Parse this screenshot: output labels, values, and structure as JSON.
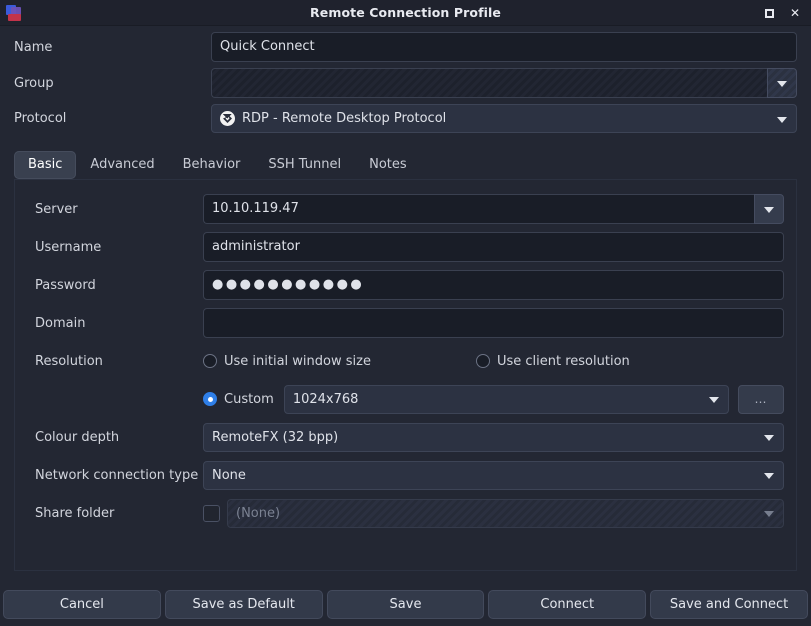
{
  "window": {
    "title": "Remote Connection Profile",
    "icon": "remmina-app-icon",
    "maximize_label": "",
    "close_label": "✕"
  },
  "top_form": {
    "name": {
      "label": "Name",
      "value": "Quick Connect",
      "placeholder": ""
    },
    "group": {
      "label": "Group",
      "value": "",
      "placeholder": ""
    },
    "protocol": {
      "label": "Protocol",
      "value": "RDP - Remote Desktop Protocol",
      "icon": "rdp-protocol-icon"
    }
  },
  "tabs": [
    {
      "label": "Basic",
      "active": true
    },
    {
      "label": "Advanced",
      "active": false
    },
    {
      "label": "Behavior",
      "active": false
    },
    {
      "label": "SSH Tunnel",
      "active": false
    },
    {
      "label": "Notes",
      "active": false
    }
  ],
  "basic": {
    "server": {
      "label": "Server",
      "value": "10.10.119.47"
    },
    "username": {
      "label": "Username",
      "value": "administrator"
    },
    "password": {
      "label": "Password",
      "value": "●●●●●●●●●●●"
    },
    "domain": {
      "label": "Domain",
      "value": ""
    },
    "resolution": {
      "label": "Resolution",
      "options": [
        {
          "label": "Use initial window size",
          "selected": false
        },
        {
          "label": "Use client resolution",
          "selected": false
        },
        {
          "label": "Custom",
          "selected": true
        }
      ],
      "custom_value": "1024x768",
      "more_button_label": "…"
    },
    "colour_depth": {
      "label": "Colour depth",
      "value": "RemoteFX (32 bpp)"
    },
    "network_connection_type": {
      "label": "Network connection type",
      "value": "None"
    },
    "share_folder": {
      "label": "Share folder",
      "checked": false,
      "value": "(None)",
      "disabled": true
    }
  },
  "buttons": [
    {
      "label": "Cancel",
      "name": "cancel-button"
    },
    {
      "label": "Save as Default",
      "name": "save-as-default-button"
    },
    {
      "label": "Save",
      "name": "save-button"
    },
    {
      "label": "Connect",
      "name": "connect-button"
    },
    {
      "label": "Save and Connect",
      "name": "save-and-connect-button"
    }
  ],
  "colors": {
    "window_bg": "#232733",
    "titlebar_bg": "#1f222d",
    "entry_bg": "#191d27",
    "button_bg": "#333a4a",
    "accent": "#2f7fe8"
  }
}
